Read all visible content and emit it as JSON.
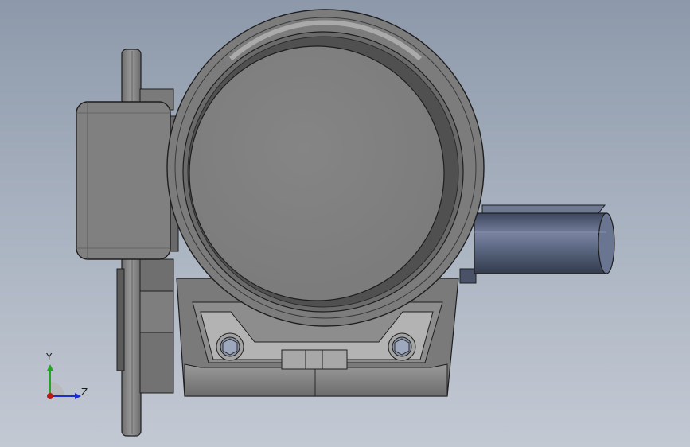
{
  "viewport": {
    "background_top": "#8d99aa",
    "background_bottom": "#c3c9d3"
  },
  "triad": {
    "y_label": "Y",
    "z_label": "Z",
    "y_color": "#1fa81f",
    "z_color": "#1a2fd0",
    "origin_color": "#c01818"
  },
  "model": {
    "body_color": "#808080",
    "shaft_color": "#5a6680",
    "edge_color": "#1e1e1e"
  }
}
